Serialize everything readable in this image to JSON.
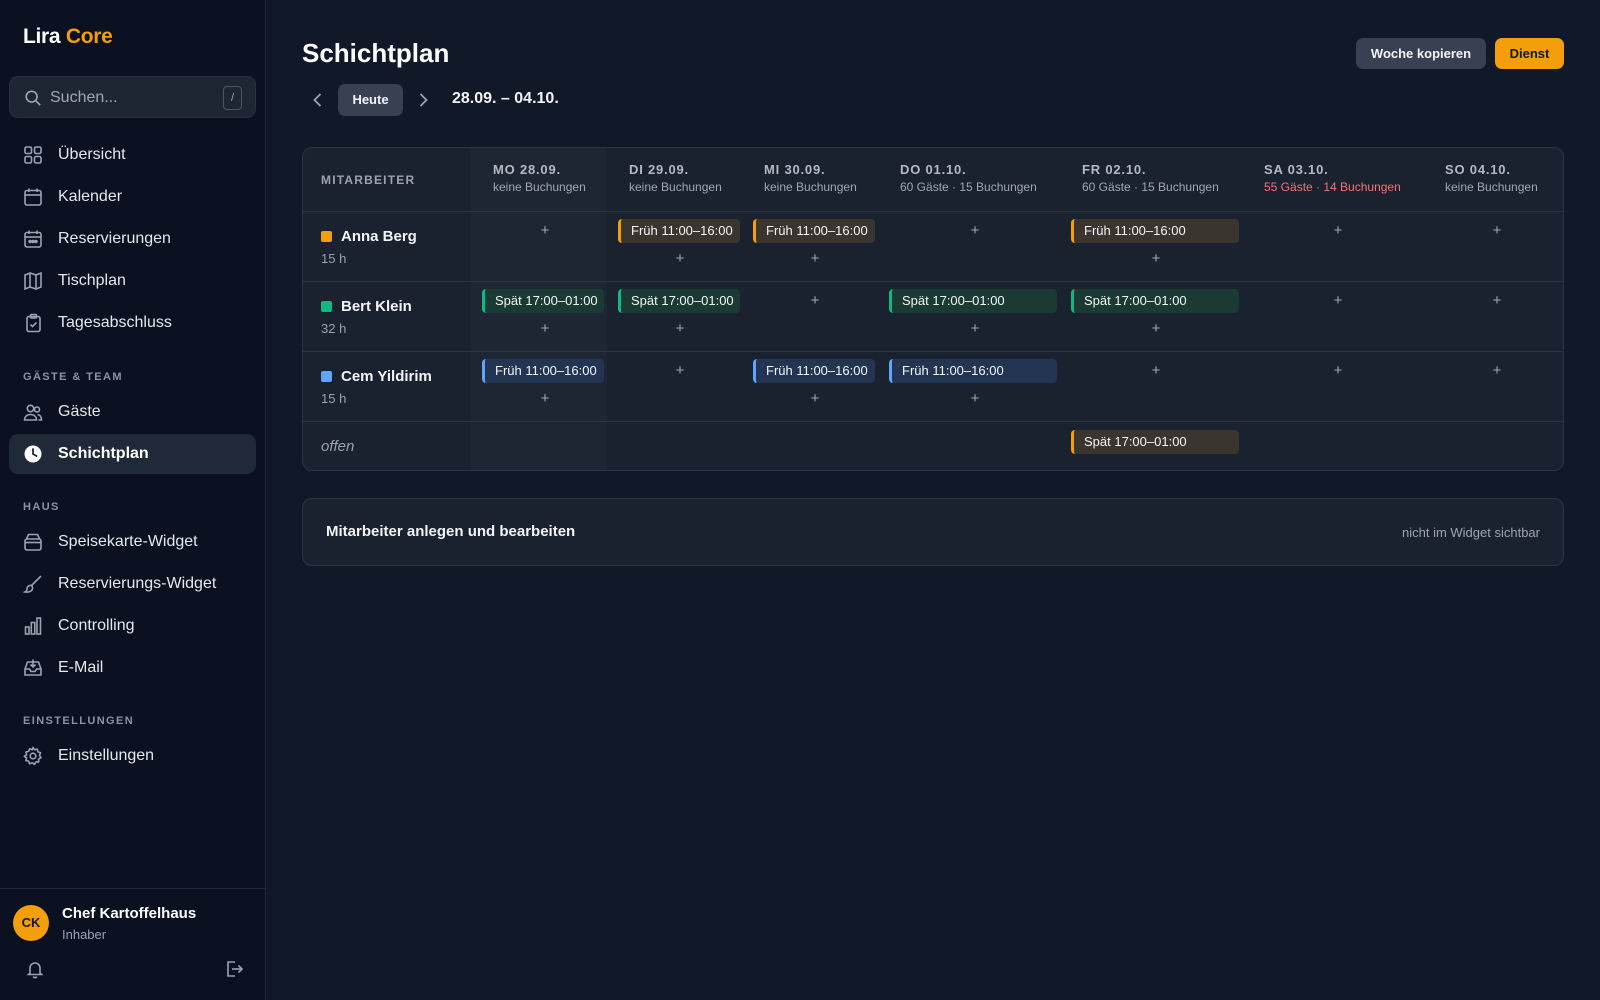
{
  "sidebar": {
    "logo_part1": "Lira",
    "logo_part2": "Core",
    "search_placeholder": "Suchen...",
    "search_shortcut": "/",
    "items_main": [
      {
        "label": "Übersicht",
        "icon": "grid-icon"
      },
      {
        "label": "Kalender",
        "icon": "calendar-icon"
      },
      {
        "label": "Reservierungen",
        "icon": "calendar-check-icon"
      },
      {
        "label": "Tischplan",
        "icon": "map-icon"
      },
      {
        "label": "Tagesabschluss",
        "icon": "clipboard-icon"
      }
    ],
    "section_team": "GÄSTE & TEAM",
    "items_team": [
      {
        "label": "Gäste",
        "icon": "users-icon"
      },
      {
        "label": "Schichtplan",
        "icon": "clock-icon",
        "active": true
      }
    ],
    "section_haus": "HAUS",
    "items_haus": [
      {
        "label": "Speisekarte-Widget",
        "icon": "box-icon"
      },
      {
        "label": "Reservierungs-Widget",
        "icon": "brush-icon"
      },
      {
        "label": "Controlling",
        "icon": "bar-chart-icon"
      },
      {
        "label": "E-Mail",
        "icon": "inbox-icon"
      }
    ],
    "section_settings": "EINSTELLUNGEN",
    "items_settings": [
      {
        "label": "Einstellungen",
        "icon": "gear-icon"
      }
    ],
    "user": {
      "initials": "CK",
      "name": "Chef Kartoffelhaus",
      "role": "Inhaber"
    }
  },
  "header": {
    "title": "Schichtplan",
    "copy_week_label": "Woche kopieren",
    "add_shift_label": "Dienst",
    "today_label": "Heute",
    "date_range": "28.09. – 04.10."
  },
  "colors": {
    "accent": "#f59e0b",
    "anna": "#f59e0b",
    "bert": "#10b981",
    "cem": "#60a5fa",
    "alert": "#f87171"
  },
  "schedule": {
    "employee_header": "MITARBEITER",
    "days": [
      {
        "name": "MO 28.09.",
        "sub": "keine Buchungen"
      },
      {
        "name": "DI 29.09.",
        "sub": "keine Buchungen"
      },
      {
        "name": "MI 30.09.",
        "sub": "keine Buchungen"
      },
      {
        "name": "DO 01.10.",
        "sub": "60 Gäste · 15 Buchungen"
      },
      {
        "name": "FR 02.10.",
        "sub": "60 Gäste · 15 Buchungen"
      },
      {
        "name": "SA 03.10.",
        "sub": "55 Gäste · 14 Buchungen",
        "alert": true
      },
      {
        "name": "SO 04.10.",
        "sub": "keine Buchungen"
      }
    ],
    "employees": [
      {
        "name": "Anna Berg",
        "hours": "15 h",
        "shifts": [
          "Früh 11:00–16:00",
          "Früh 11:00–16:00",
          "Früh 11:00–16:00"
        ]
      },
      {
        "name": "Bert Klein",
        "hours": "32 h",
        "shifts": [
          "Spät 17:00–01:00",
          "Spät 17:00–01:00",
          "Spät 17:00–01:00",
          "Spät 17:00–01:00"
        ]
      },
      {
        "name": "Cem Yildirim",
        "hours": "15 h",
        "shifts": [
          "Früh 11:00–16:00",
          "Früh 11:00–16:00",
          "Früh 11:00–16:00"
        ]
      }
    ],
    "open_label": "offen",
    "open_shift": "Spät 17:00–01:00",
    "add_symbol": "+"
  },
  "info": {
    "title": "Mitarbeiter anlegen und bearbeiten",
    "note": "nicht im Widget sichtbar"
  }
}
